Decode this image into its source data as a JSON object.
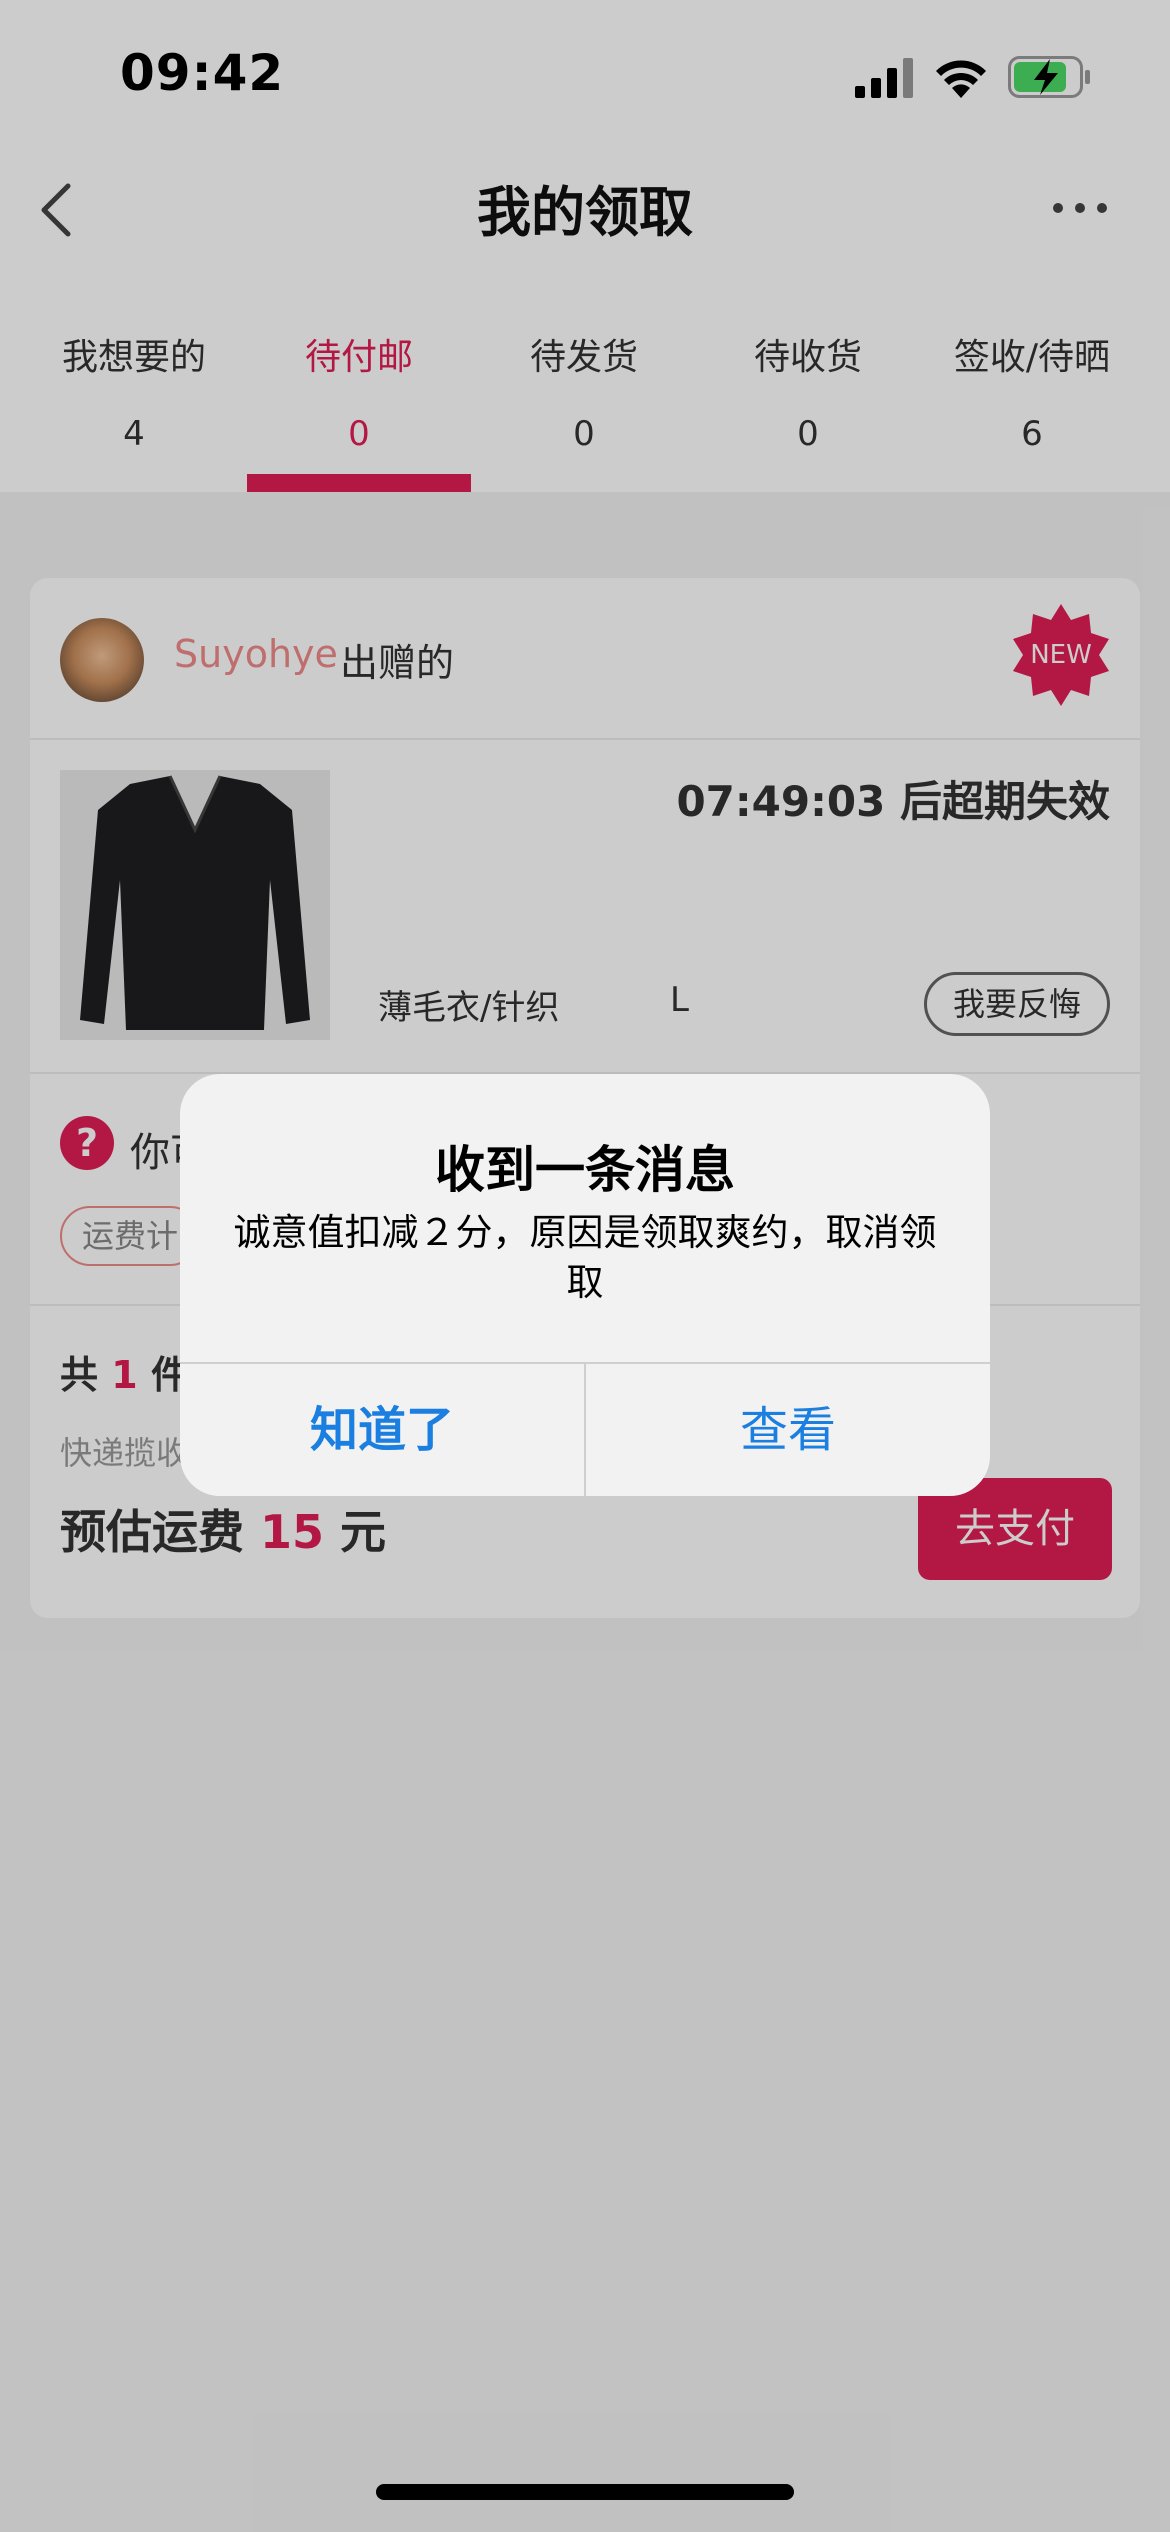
{
  "status_bar": {
    "time": "09:42"
  },
  "nav": {
    "title": "我的领取"
  },
  "tabs": [
    {
      "label": "我想要的",
      "count": "4"
    },
    {
      "label": "待付邮",
      "count": "0",
      "active": true
    },
    {
      "label": "待发货",
      "count": "0"
    },
    {
      "label": "待收货",
      "count": "0"
    },
    {
      "label": "签收/待晒",
      "count": "6"
    }
  ],
  "card": {
    "seller_name": "Suyohye",
    "seller_suffix": "出赠的",
    "badge": "NEW",
    "countdown": "07:49:03 后超期失效",
    "category": "薄毛衣/针织",
    "size": "L",
    "regret_label": "我要反悔",
    "question_icon": "?",
    "question_text": "你可",
    "freight_tag": "运费计",
    "summary_prefix": "共",
    "summary_count": "1",
    "summary_suffix": "件",
    "pickup_text": "快递揽收",
    "fee_label": "预估运费",
    "fee_value": "15",
    "fee_unit": "元",
    "pay_label": "去支付"
  },
  "alert": {
    "title": "收到一条消息",
    "message": "诚意值扣减２分，原因是领取爽约，取消领取",
    "ok_label": "知道了",
    "view_label": "查看"
  },
  "colors": {
    "accent": "#e01f55",
    "ios_blue": "#1a7fe0",
    "seller_name": "#ef8a8a"
  }
}
